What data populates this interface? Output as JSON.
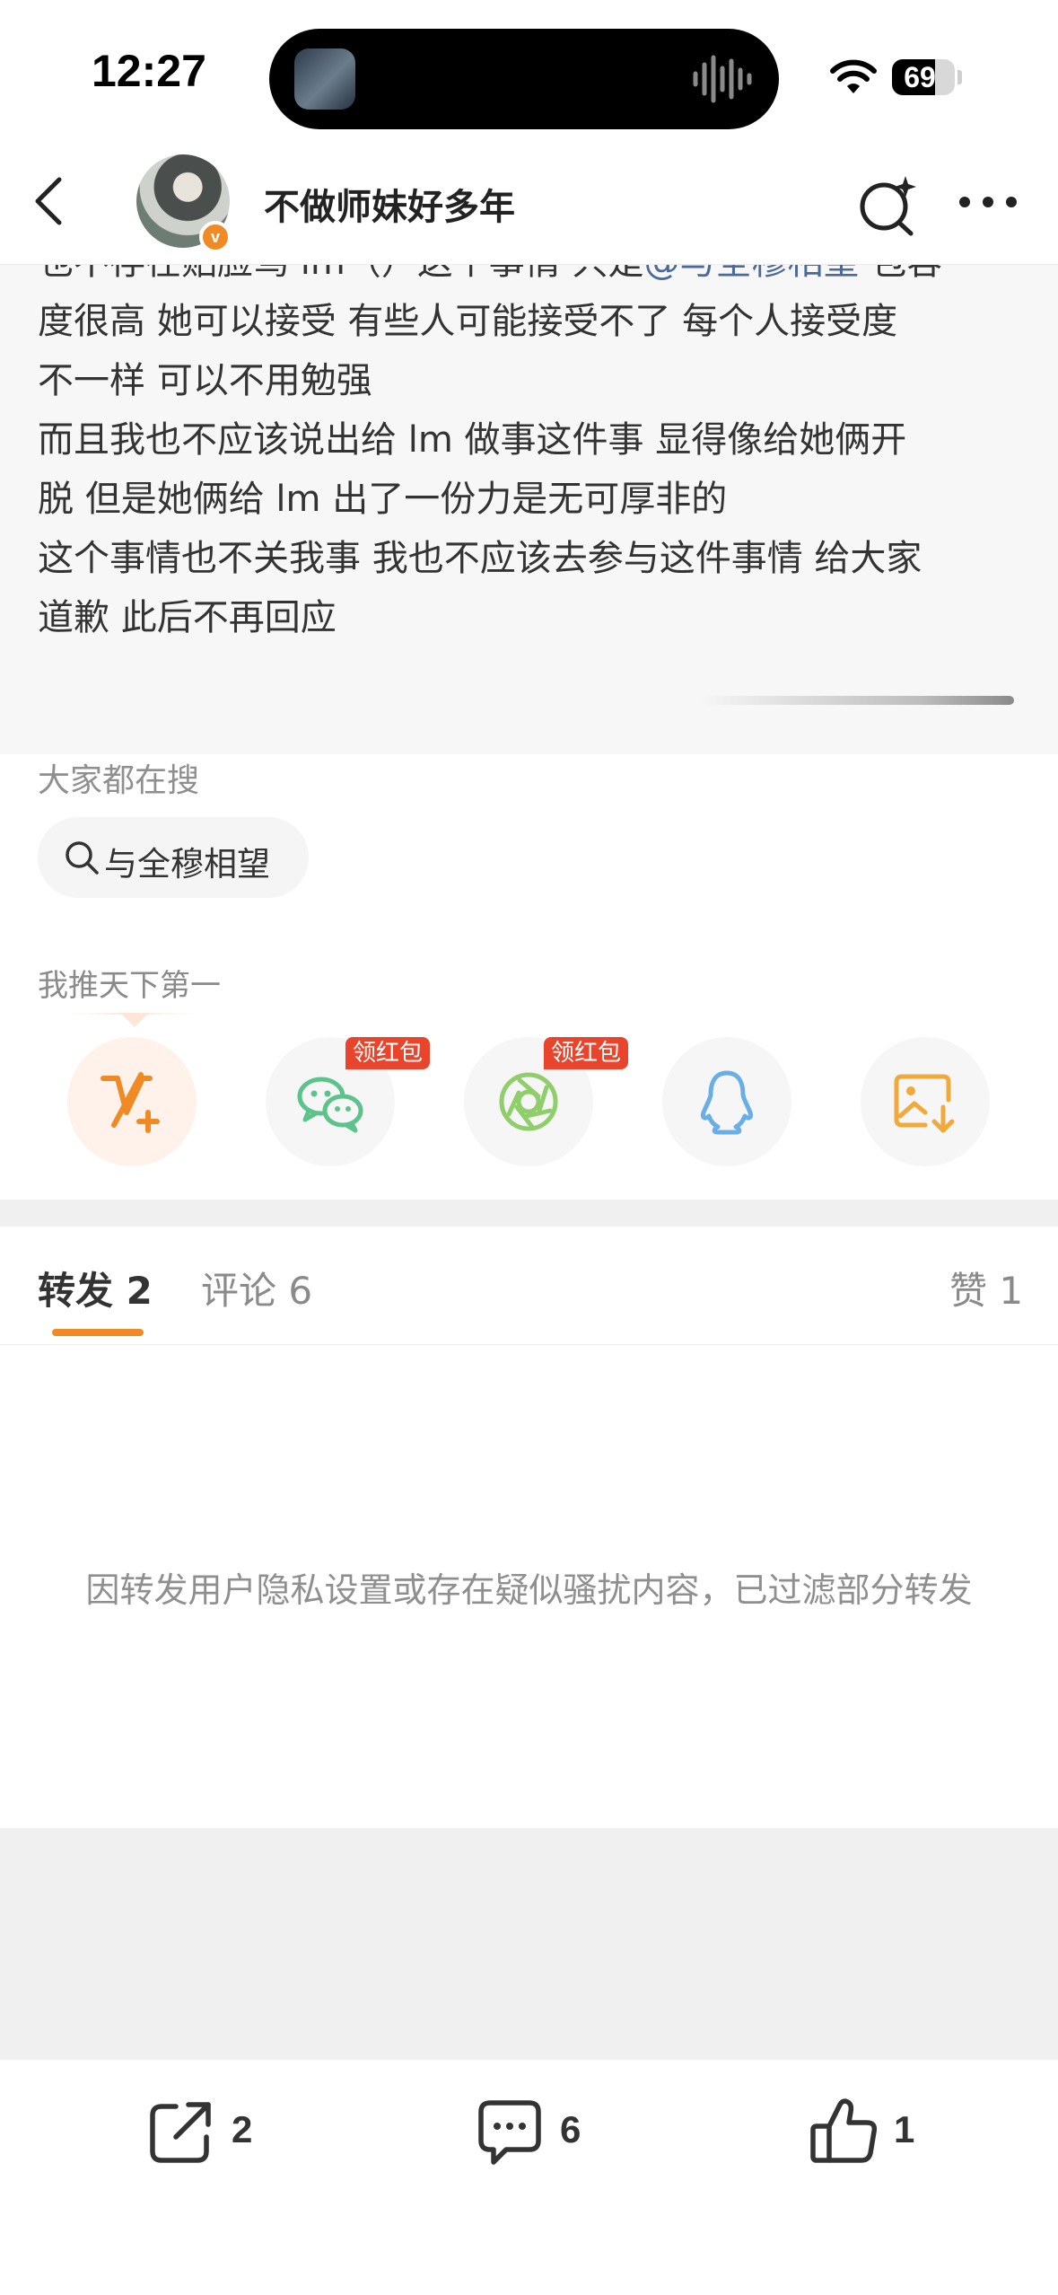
{
  "status_bar": {
    "time": "12:27",
    "battery": "69",
    "battery_level": 0.69
  },
  "header": {
    "user_name": "不做师妹好多年"
  },
  "post": {
    "lines": [
      {
        "parts": [
          "也不存在贴脸骂 lm（）这个事情 只是",
          "@与全穆相望",
          " 包容"
        ]
      },
      {
        "text": "度很高 她可以接受 有些人可能接受不了 每个人接受度"
      },
      {
        "text": "不一样 可以不用勉强"
      },
      {
        "text": "而且我也不应该说出给 lm 做事这件事 显得像给她俩开"
      },
      {
        "text": "脱 但是她俩给 lm 出了一份力是无可厚非的"
      },
      {
        "text": "这个事情也不关我事 我也不应该去参与这件事情 给大家"
      },
      {
        "text": "道歉 此后不再回应"
      }
    ]
  },
  "hot_search": {
    "label": "大家都在搜",
    "chip": "与全穆相望"
  },
  "share": {
    "label": "我推天下第一",
    "badge": "领红包",
    "targets": [
      {
        "icon": "v-plus-icon",
        "badge": ""
      },
      {
        "icon": "wechat-icon",
        "badge": "领红包"
      },
      {
        "icon": "moments-icon",
        "badge": "领红包"
      },
      {
        "icon": "qq-icon",
        "badge": ""
      },
      {
        "icon": "save-image-icon",
        "badge": ""
      }
    ],
    "colors": {
      "v_plus": "#f08a24",
      "wechat": "#5cc38a",
      "moments": "#8fce6a",
      "qq": "#6aaee6",
      "save": "#f0a93a"
    }
  },
  "tabs": {
    "repost": "转发",
    "repost_count": "2",
    "comment": "评论",
    "comment_count": "6",
    "like": "赞",
    "like_count": "1",
    "active": "repost"
  },
  "filter_notice": "因转发用户隐私设置或存在疑似骚扰内容，已过滤部分转发",
  "actions": {
    "repost_count": "2",
    "comment_count": "6",
    "like_count": "1"
  },
  "accent_color": "#f08a24",
  "mention_color": "#4a6a9c"
}
